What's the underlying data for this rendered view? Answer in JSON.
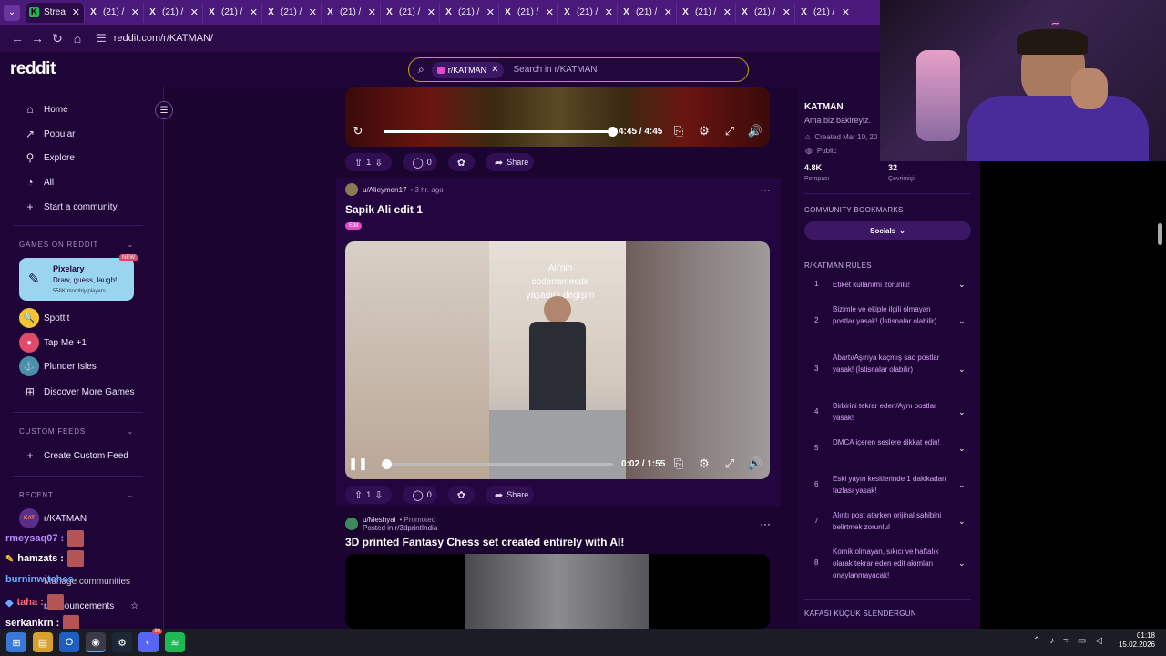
{
  "browser": {
    "tabs": [
      {
        "label": "Strea",
        "icon": "stream-icon",
        "active": true
      },
      {
        "label": "(21) /",
        "icon": "x-icon"
      },
      {
        "label": "(21) /",
        "icon": "x-icon"
      },
      {
        "label": "(21) /",
        "icon": "x-icon"
      },
      {
        "label": "(21) /",
        "icon": "x-icon"
      },
      {
        "label": "(21) /",
        "icon": "x-icon"
      },
      {
        "label": "(21) /",
        "icon": "x-icon"
      },
      {
        "label": "(21) /",
        "icon": "x-icon"
      },
      {
        "label": "(21) /",
        "icon": "x-icon"
      },
      {
        "label": "(21) /",
        "icon": "x-icon"
      },
      {
        "label": "(21) /",
        "icon": "x-icon"
      },
      {
        "label": "(21) /",
        "icon": "x-icon"
      },
      {
        "label": "(21) /",
        "icon": "x-icon"
      },
      {
        "label": "(21) /",
        "icon": "x-icon"
      }
    ],
    "url": "reddit.com/r/KATMAN/"
  },
  "header": {
    "logo": "reddit",
    "search_chip": "r/KATMAN",
    "search_placeholder": "Search in r/KATMAN"
  },
  "sidebar": {
    "nav": [
      {
        "label": "Home",
        "icon": "home-icon"
      },
      {
        "label": "Popular",
        "icon": "popular-icon"
      },
      {
        "label": "Explore",
        "icon": "explore-icon"
      },
      {
        "label": "All",
        "icon": "all-icon"
      },
      {
        "label": "Start a community",
        "icon": "plus-icon"
      }
    ],
    "games_header": "GAMES ON REDDIT",
    "pixelary": {
      "title": "Pixelary",
      "subtitle": "Draw, guess, laugh!",
      "players": "558K monthly players",
      "badge": "NEW"
    },
    "games": [
      "Spottit",
      "Tap Me +1",
      "Plunder Isles",
      "Discover More Games"
    ],
    "custom_header": "CUSTOM FEEDS",
    "create_feed": "Create Custom Feed",
    "recent_header": "RECENT",
    "recent": [
      "r/KATMAN"
    ],
    "manage": "Manage communities",
    "announcements": "r/announcements"
  },
  "chat": [
    {
      "user": "rmeysaq07 :",
      "color": "#b98cff"
    },
    {
      "user": "hamzats :",
      "color": "#ffffff"
    },
    {
      "user": "burninwitches",
      "color": "#6aa9ff"
    },
    {
      "user": "taha :",
      "color": "#ff6b6b"
    },
    {
      "user": "serkankrn :",
      "color": "#ffffff"
    },
    {
      "user": ":",
      "color": "#ff6b6b"
    }
  ],
  "post1": {
    "time": "4:45 / 4:45",
    "progress": 1.0,
    "votes": "1",
    "comments": "0",
    "share": "Share"
  },
  "post2": {
    "user": "u/Alieymen17",
    "time": "• 3 hr. ago",
    "title": "Sapik Ali edit 1",
    "flair": "Edit",
    "overlay": "Ali'nin codenamesde yaşadığı değişim",
    "video_time": "0:02 / 1:55",
    "progress": 0.017,
    "votes": "1",
    "comments": "0",
    "share": "Share"
  },
  "post3": {
    "user": "u/Meshyai",
    "promoted": "• Promoted",
    "posted_in": "Posted in r/3dprintIndia",
    "title": "3D printed Fantasy Chess set created entirely with AI!"
  },
  "community": {
    "name": "KATMAN",
    "tagline": "Ama biz bakireyiz.",
    "created": "Created Mar 10, 20",
    "visibility": "Public",
    "members": "4.8K",
    "members_label": "Pompacı",
    "online": "32",
    "online_label": "Çevrimiçi",
    "bookmarks_header": "COMMUNITY BOOKMARKS",
    "socials": "Socials",
    "rules_header": "R/KATMAN RULES",
    "rules": [
      {
        "n": "1",
        "text": "Etiket kullanımı zorunlu!"
      },
      {
        "n": "2",
        "text": "Bizimle ve ekiple ilgili olmayan postlar yasak! (İstisnalar olabilir)"
      },
      {
        "n": "3",
        "text": "Abartı/Aşırıya kaçmış sad postlar yasak! (İstisnalar olabilir)"
      },
      {
        "n": "4",
        "text": "Birbirini tekrar eden/Aynı postlar yasak!"
      },
      {
        "n": "5",
        "text": "DMCA içeren seslere dikkat edin!"
      },
      {
        "n": "6",
        "text": "Eski yayın kesitlerinde 1 dakikadan fazlası yasak!"
      },
      {
        "n": "7",
        "text": "Alıntı post atarken orijinal sahibini belirtmek zorunlu!"
      },
      {
        "n": "8",
        "text": "Komik olmayan, sıkıcı ve haftalık olarak tekrar eden edit akımları onaylanmayacak!"
      }
    ],
    "footer_header": "KAFASI KÜÇÜK SLENDERGUN"
  },
  "taskbar": {
    "time": "01:18",
    "date": "15.02.2026",
    "discord_badge": "99"
  },
  "colors": {
    "accent": "#e04bc7",
    "bg": "#1b0430",
    "search_border": "#c9a300"
  }
}
